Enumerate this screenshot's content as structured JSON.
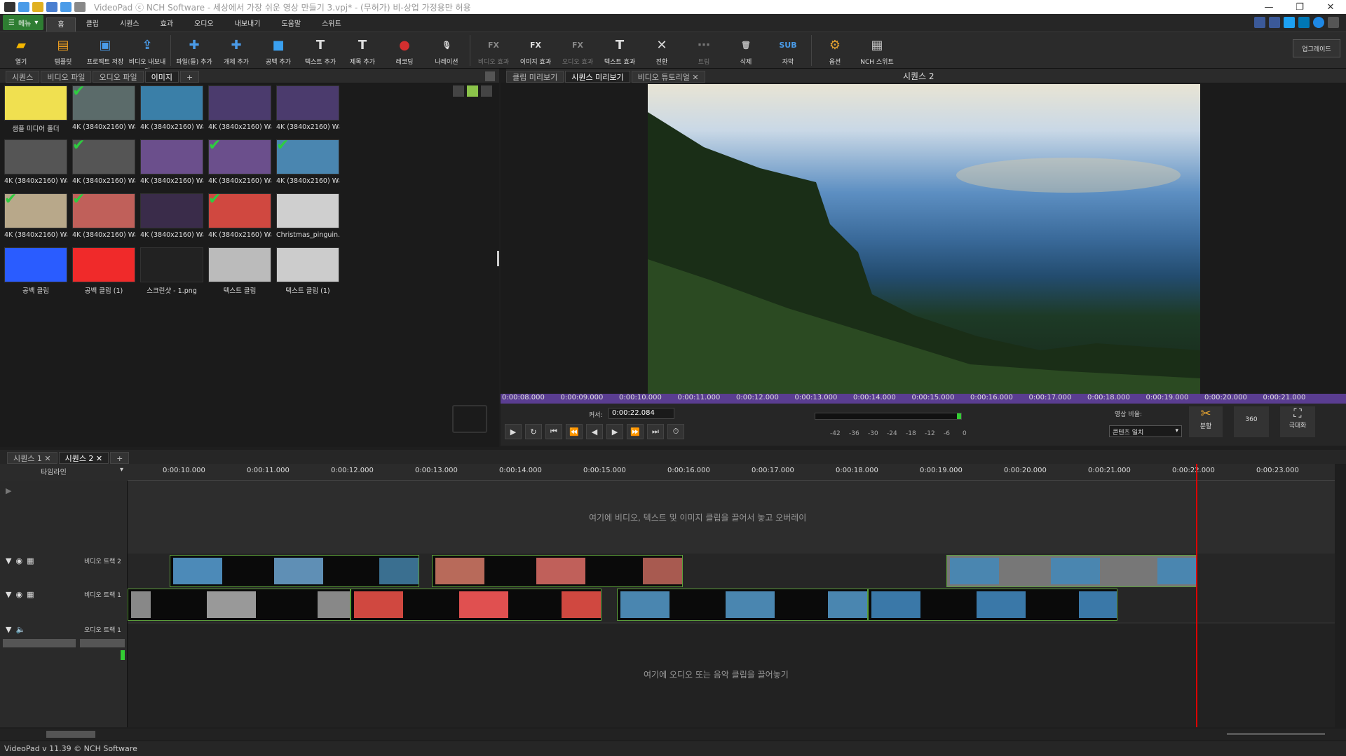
{
  "window": {
    "title": "VideoPad ⓒ NCH Software - 세상에서 가장 쉬운 영상 만들기 3.vpj* - (무허가) 비-상업 가정용만 허용",
    "controls": [
      "—",
      "❐",
      "✕"
    ]
  },
  "menu": {
    "menu_label": "메뉴",
    "tabs": [
      "홈",
      "클립",
      "시퀀스",
      "효과",
      "오디오",
      "내보내기",
      "도움말",
      "스위트"
    ],
    "active": "홈"
  },
  "toolbar": {
    "buttons": [
      {
        "label": "열기",
        "icon": "folder-open-icon",
        "color": "#f5b700",
        "glyph": "▰"
      },
      {
        "label": "템플릿",
        "icon": "template-icon",
        "color": "#f0a020",
        "glyph": "▤"
      },
      {
        "label": "프로젝트 저장",
        "icon": "save-icon",
        "color": "#4a9be8",
        "glyph": "▣"
      },
      {
        "label": "비디오 내보내기",
        "icon": "export-video-icon",
        "color": "#4a9be8",
        "glyph": "⇪"
      },
      {
        "label": "파일(들) 추가",
        "icon": "add-files-icon",
        "color": "#4a9be8",
        "glyph": "✚"
      },
      {
        "label": "개체 추가",
        "icon": "add-object-icon",
        "color": "#4a9be8",
        "glyph": "✚"
      },
      {
        "label": "공백 추가",
        "icon": "add-blank-icon",
        "color": "#3aa0f0",
        "glyph": "■"
      },
      {
        "label": "텍스트 추가",
        "icon": "add-text-icon",
        "color": "#ddd",
        "glyph": "T"
      },
      {
        "label": "제목 추가",
        "icon": "add-title-icon",
        "color": "#ddd",
        "glyph": "T"
      },
      {
        "label": "레코딩",
        "icon": "record-icon",
        "color": "#d32f2f",
        "glyph": "●"
      },
      {
        "label": "나레이션",
        "icon": "narration-icon",
        "color": "#ddd",
        "glyph": "🎙"
      },
      {
        "label": "비디오 효과",
        "icon": "video-effect-icon",
        "color": "#888",
        "glyph": "FX",
        "disabled": true
      },
      {
        "label": "이미지 효과",
        "icon": "image-effect-icon",
        "color": "#ddd",
        "glyph": "FX"
      },
      {
        "label": "오디오 효과",
        "icon": "audio-effect-icon",
        "color": "#888",
        "glyph": "FX",
        "disabled": true
      },
      {
        "label": "텍스트 효과",
        "icon": "text-effect-icon",
        "color": "#ddd",
        "glyph": "T"
      },
      {
        "label": "전환",
        "icon": "transition-icon",
        "color": "#ddd",
        "glyph": "✕"
      },
      {
        "label": "트림",
        "icon": "trim-icon",
        "color": "#777",
        "glyph": "⋯",
        "disabled": true
      },
      {
        "label": "삭제",
        "icon": "delete-icon",
        "color": "#bbb",
        "glyph": "🗑"
      },
      {
        "label": "자막",
        "icon": "subtitle-icon",
        "color": "#4a9be8",
        "glyph": "SUB"
      },
      {
        "label": "옵션",
        "icon": "options-icon",
        "color": "#e0a030",
        "glyph": "⚙"
      },
      {
        "label": "NCH 스위트",
        "icon": "nch-suite-icon",
        "color": "#bbb",
        "glyph": "▦"
      }
    ],
    "upgrade": "업그레이드"
  },
  "bin": {
    "tabs": [
      "시퀀스",
      "비디오 파일",
      "오디오 파일",
      "이미지"
    ],
    "tab_add": "+",
    "active": "이미지",
    "items": [
      {
        "label": "샘플 미디어 폴더",
        "color": "#f0e050",
        "check": false
      },
      {
        "label": "4K (3840x2160) Wallp...",
        "color": "#5b6b6a",
        "check": true
      },
      {
        "label": "4K (3840x2160) Wallp...",
        "color": "#3a7fa8",
        "check": false
      },
      {
        "label": "4K (3840x2160) Wallp...",
        "color": "#4b3b6d",
        "check": false
      },
      {
        "label": "4K (3840x2160) Wallp...",
        "color": "#4b3b6d",
        "check": false
      },
      {
        "label": "4K (3840x2160) Wallp...",
        "color": "#555",
        "check": false
      },
      {
        "label": "4K (3840x2160) Wallp...",
        "color": "#555",
        "check": true
      },
      {
        "label": "4K (3840x2160) Wallp...",
        "color": "#6b4f8c",
        "check": false
      },
      {
        "label": "4K (3840x2160) Wallp...",
        "color": "#6b4f8c",
        "check": true
      },
      {
        "label": "4K (3840x2160) Wallp...",
        "color": "#4a86b0",
        "check": true
      },
      {
        "label": "4K (3840x2160) Wallp...",
        "color": "#b8a88a",
        "check": true
      },
      {
        "label": "4K (3840x2160) Wallp...",
        "color": "#c0605a",
        "check": true
      },
      {
        "label": "4K (3840x2160) Wallp...",
        "color": "#3a2c4a",
        "check": false
      },
      {
        "label": "4K (3840x2160) Wallp...",
        "color": "#d04840",
        "check": true
      },
      {
        "label": "Christmas_pinguin.png",
        "color": "#cfcfcf",
        "check": false
      },
      {
        "label": "공백 클립",
        "color": "#2a5cff",
        "check": false
      },
      {
        "label": "공백 클립 (1)",
        "color": "#f02a2a",
        "check": false
      },
      {
        "label": "스크린샷 - 1.png",
        "color": "#222",
        "check": false
      },
      {
        "label": "텍스트 클립",
        "color": "#bbb",
        "check": false
      },
      {
        "label": "텍스트 클립 (1)",
        "color": "#ccc",
        "check": false
      }
    ]
  },
  "preview": {
    "tabs": [
      "클립 미리보기",
      "시퀀스 미리보기",
      "비디오 튜토리얼"
    ],
    "active": "시퀀스 미리보기",
    "sequence_title": "시퀀스 2",
    "ruler_ticks": [
      "0:00:08.000",
      "0:00:09.000",
      "0:00:10.000",
      "0:00:11.000",
      "0:00:12.000",
      "0:00:13.000",
      "0:00:14.000",
      "0:00:15.000",
      "0:00:16.000",
      "0:00:17.000",
      "0:00:18.000",
      "0:00:19.000",
      "0:00:20.000",
      "0:00:21.000"
    ],
    "cursor_label": "커서:",
    "cursor_value": "0:00:22.084",
    "meter_ticks": [
      "-42",
      "-36",
      "-30",
      "-24",
      "-18",
      "-12",
      "-6",
      "0"
    ],
    "aspect_label": "영상 비율:",
    "aspect_value": "콘텐츠 일치",
    "split": "분할",
    "vr": "360",
    "fullscreen": "극대화"
  },
  "timeline": {
    "tabs": [
      "시퀀스 1",
      "시퀀스 2"
    ],
    "active": "시퀀스 2",
    "tab_add": "+",
    "mode": "타임라인",
    "ruler_ticks": [
      "0:00:10.000",
      "0:00:11.000",
      "0:00:12.000",
      "0:00:13.000",
      "0:00:14.000",
      "0:00:15.000",
      "0:00:16.000",
      "0:00:17.000",
      "0:00:18.000",
      "0:00:19.000",
      "0:00:20.000",
      "0:00:21.000",
      "0:00:22.000",
      "0:00:23.000"
    ],
    "overlay_hint": "여기에 비디오, 텍스트 및 이미지 클립을 끌어서 놓고 오버레이",
    "audio_hint": "여기에 오디오 또는 음악 클립을 끌어놓기",
    "tracks": [
      "비디오 트랙 2",
      "비디오 트랙 1",
      "오디오 트랙 1"
    ]
  },
  "status": {
    "text": "VideoPad v 11.39 © NCH Software"
  }
}
